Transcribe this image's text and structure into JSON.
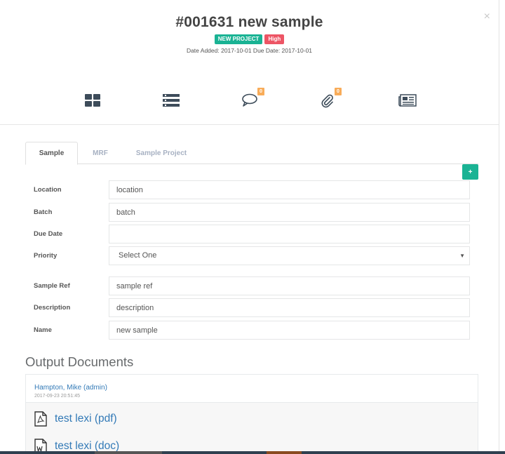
{
  "header": {
    "close_label": "×",
    "title": "#001631 new sample",
    "badges": {
      "status": "NEW PROJECT",
      "priority": "High"
    },
    "dates": "Date Added: 2017-10-01 Due Date: 2017-10-01"
  },
  "icon_bar": {
    "items": [
      {
        "name": "dashboard-grid-icon"
      },
      {
        "name": "list-rows-icon"
      },
      {
        "name": "comment-icon",
        "count": "0"
      },
      {
        "name": "attachment-icon",
        "count": "0"
      },
      {
        "name": "newspaper-icon"
      }
    ]
  },
  "tabs": [
    {
      "label": "Sample",
      "active": true
    },
    {
      "label": "MRF",
      "active": false
    },
    {
      "label": "Sample Project",
      "active": false
    }
  ],
  "add_button_label": "+",
  "form": {
    "location": {
      "label": "Location",
      "value": "location"
    },
    "batch": {
      "label": "Batch",
      "value": "batch"
    },
    "due_date": {
      "label": "Due Date",
      "value": ""
    },
    "priority": {
      "label": "Priority",
      "value": "Select One"
    },
    "sample_ref": {
      "label": "Sample Ref",
      "value": "sample ref"
    },
    "description": {
      "label": "Description",
      "value": "description"
    },
    "name": {
      "label": "Name",
      "value": "new sample"
    }
  },
  "output_documents": {
    "title": "Output Documents",
    "user": "Hampton, Mike (admin)",
    "timestamp": "2017-09-23 20:51:45",
    "files": [
      {
        "label": "test lexi (pdf)",
        "icon": "pdf-file-icon"
      },
      {
        "label": "test lexi (doc)",
        "icon": "word-file-icon"
      }
    ]
  },
  "colors": {
    "accent_green": "#1ab394",
    "badge_red": "#ed5565",
    "counter_orange": "#f8ac59",
    "link_blue": "#337ab7"
  }
}
